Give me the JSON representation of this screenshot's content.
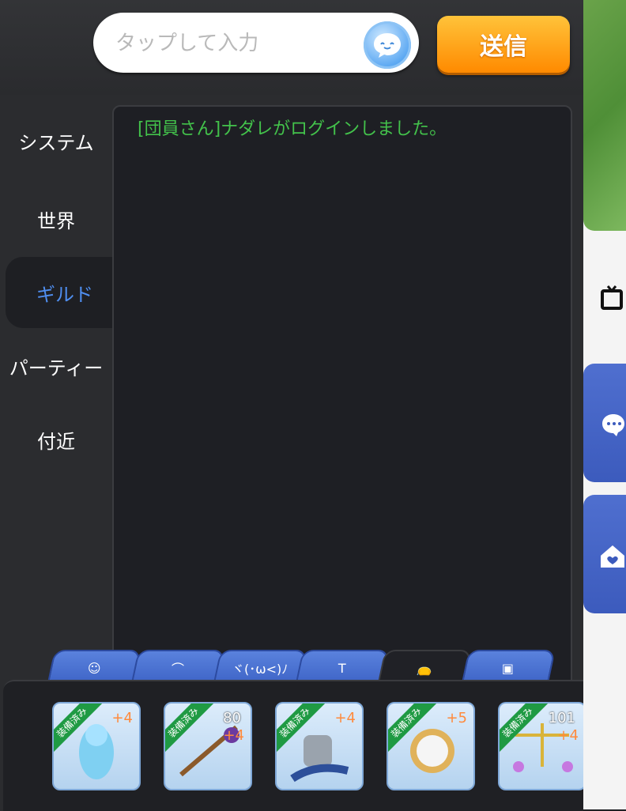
{
  "input": {
    "placeholder": "タップして入力"
  },
  "send": {
    "label": "送信"
  },
  "tabs": [
    {
      "label": "システム"
    },
    {
      "label": "世界"
    },
    {
      "label": "ギルド"
    },
    {
      "label": "パーティー"
    },
    {
      "label": "付近"
    }
  ],
  "chat": {
    "message": "[団員さん]ナダレがログインしました。"
  },
  "input_tabs": [
    {
      "label": "☺"
    },
    {
      "label": "⌒"
    },
    {
      "label": "ヾ(･ω<)ﾉ"
    },
    {
      "label": "T"
    },
    {
      "label": "👝"
    },
    {
      "label": "▣"
    }
  ],
  "items": [
    {
      "badge": "装備済み",
      "plus": "+4",
      "level": ""
    },
    {
      "badge": "装備済み",
      "plus": "+4",
      "level": "80"
    },
    {
      "badge": "装備済み",
      "plus": "+4",
      "level": ""
    },
    {
      "badge": "装備済み",
      "plus": "+5",
      "level": ""
    },
    {
      "badge": "装備済み",
      "plus": "+4",
      "level": "101"
    }
  ],
  "colors": {
    "accent": "#4f8ef0",
    "send": "#ff9a1a",
    "message": "#43c24b"
  }
}
